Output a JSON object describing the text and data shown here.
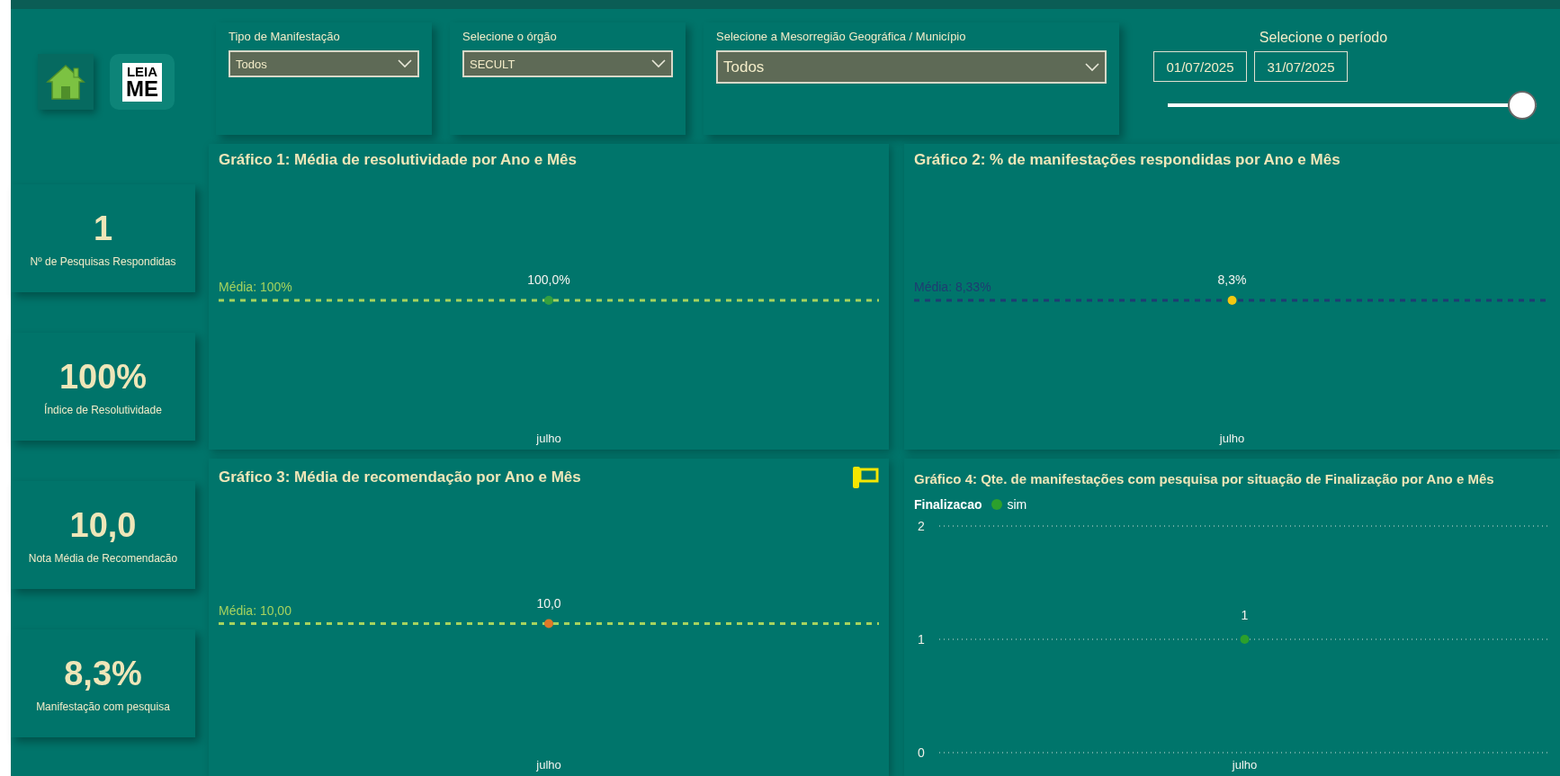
{
  "header": {
    "readme_logo": {
      "lines": [
        "LEIA",
        "ME"
      ]
    }
  },
  "filters": [
    {
      "kind": "dropdown",
      "label": "Tipo de Manifestação",
      "value": "Todos"
    },
    {
      "kind": "dropdown",
      "label": "Selecione o órgão",
      "value": "SECULT"
    },
    {
      "kind": "dropdown",
      "label": "Selecione a Mesorregião Geográfica / Município",
      "value": "Todos"
    },
    {
      "kind": "period",
      "label": "Selecione o período",
      "start": "01/07/2025",
      "end": "31/07/2025",
      "level": 1
    }
  ],
  "kpis": [
    {
      "value": "1",
      "label": "Nº de Pesquisas Respondidas"
    },
    {
      "value": "100%",
      "label": "Índice de Resolutividade"
    },
    {
      "value": "10,0",
      "label": "Nota Média de Recomendacão"
    },
    {
      "value": "8,3%",
      "label": "Manifestação com pesquisa"
    }
  ],
  "charts": [
    {
      "kind": "average-plot",
      "title": "Gráfico 1: Média de resolutividade por Ano e Mês",
      "category": "julho",
      "value_label": "100,0%",
      "point": {
        "color": "#35a040"
      },
      "average": {
        "label": "Média: 100%",
        "color": "#a6d35e"
      }
    },
    {
      "kind": "average-plot",
      "title": "Gráfico 2: % de manifestações respondidas por Ano e Mês",
      "category": "julho",
      "value_label": "8,3%",
      "point": {
        "color": "#f2c811"
      },
      "average": {
        "label": "Média: 8,33%",
        "color": "#1e3c72"
      }
    },
    {
      "kind": "average-plot",
      "badge_icon": true,
      "title": "Gráfico 3: Média de recomendação por Ano e Mês",
      "category": "julho",
      "value_label": "10,0",
      "point": {
        "color": "#e0782a"
      },
      "average": {
        "label": "Média: 10,00",
        "color": "#a6d35e"
      }
    },
    {
      "kind": "chart",
      "legend_title": "Finalizacao",
      "chart_data": {
        "type": "line",
        "title": "Gráfico 4: Qte. de manifestações com pesquisa por situação de Finalização por Ano e Mês",
        "categories": [
          "julho"
        ],
        "series": [
          {
            "name": "sim",
            "color": "#2ca02c",
            "marker": "circle",
            "values": [
              1
            ]
          }
        ],
        "ylim": [
          0,
          2
        ],
        "yticks": [
          0,
          1,
          2
        ],
        "data_labels": true
      }
    }
  ]
}
